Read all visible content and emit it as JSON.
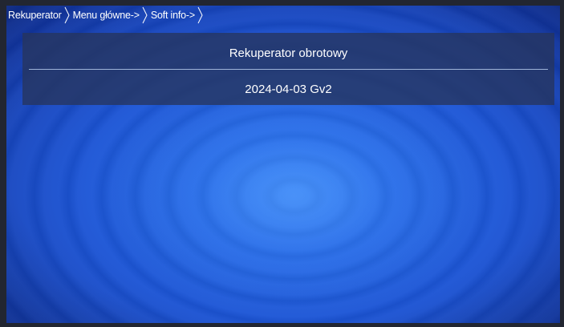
{
  "breadcrumb": {
    "items": [
      {
        "label": "Rekuperator"
      },
      {
        "label": "Menu główne->"
      },
      {
        "label": "Soft info->"
      }
    ]
  },
  "info_panel": {
    "device_name": "Rekuperator obrotowy",
    "version": "2024-04-03 Gv2"
  },
  "colors": {
    "screen_blue": "#1c55d6",
    "panel": "#26345c",
    "text": "#ffffff"
  }
}
